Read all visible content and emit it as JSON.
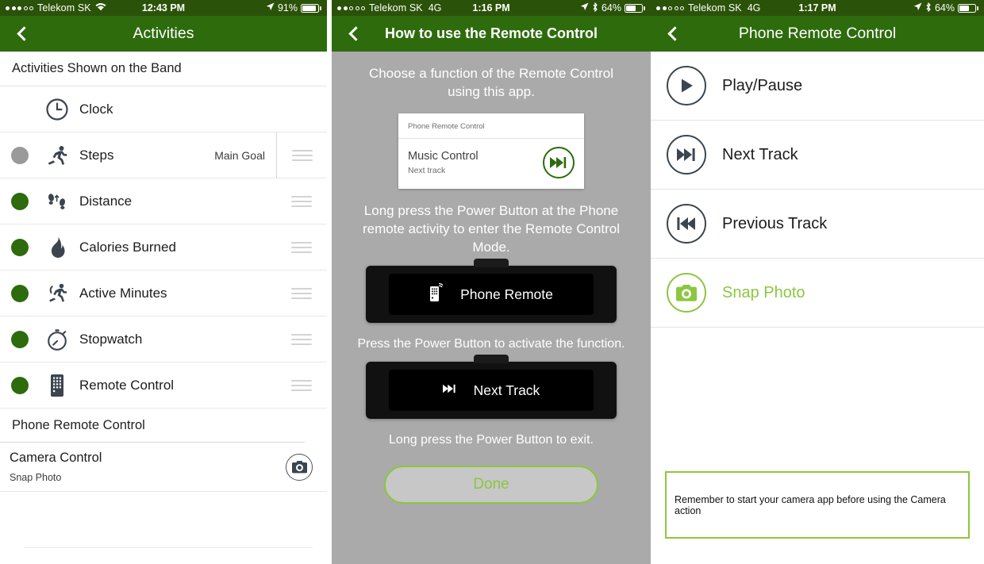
{
  "panel1": {
    "status": {
      "carrier": "Telekom SK",
      "network": "wifi",
      "time": "12:43 PM",
      "battery": "91%",
      "battery_pct": 91,
      "signal_filled": 3,
      "signal_total": 5
    },
    "nav": {
      "title": "Activities",
      "back": "back-chevron"
    },
    "section_header": "Activities Shown on the Band",
    "rows": [
      {
        "label": "Clock",
        "icon": "clock-icon",
        "toggle": "none",
        "badge": "",
        "handle": false,
        "separator": false
      },
      {
        "label": "Steps",
        "icon": "running-icon",
        "toggle": "off",
        "badge": "Main Goal",
        "handle": true,
        "separator": true
      },
      {
        "label": "Distance",
        "icon": "footsteps-icon",
        "toggle": "on",
        "badge": "",
        "handle": true,
        "separator": false
      },
      {
        "label": "Calories Burned",
        "icon": "flame-icon",
        "toggle": "on",
        "badge": "",
        "handle": true,
        "separator": false
      },
      {
        "label": "Active Minutes",
        "icon": "active-runner-icon",
        "toggle": "on",
        "badge": "",
        "handle": true,
        "separator": false
      },
      {
        "label": "Stopwatch",
        "icon": "stopwatch-icon",
        "toggle": "on",
        "badge": "",
        "handle": true,
        "separator": false
      },
      {
        "label": "Remote Control",
        "icon": "remote-icon",
        "toggle": "on",
        "badge": "",
        "handle": true,
        "separator": false
      }
    ],
    "sub_header": "Phone Remote Control",
    "camera_row": {
      "title": "Camera Control",
      "subtitle": "Snap Photo",
      "icon": "camera-icon"
    }
  },
  "panel2": {
    "status": {
      "carrier": "Telekom SK",
      "network": "4G",
      "time": "1:16 PM",
      "battery": "64%",
      "battery_pct": 64,
      "signal_filled": 2,
      "signal_total": 5
    },
    "nav": {
      "title": "How to use the Remote Control",
      "back": "back-chevron"
    },
    "caption1": "Choose a function of the Remote Control using this app.",
    "card": {
      "header": "Phone Remote Control",
      "title": "Music Control",
      "subtitle": "Next track",
      "icon": "next-track-icon"
    },
    "caption2": "Long press the Power Button at the Phone remote activity to enter the Remote Control Mode.",
    "band1": {
      "label": "Phone Remote",
      "icon": "remote-signal-icon"
    },
    "caption3": "Press the Power Button to activate the function.",
    "band2": {
      "label": "Next Track",
      "icon": "next-track-icon"
    },
    "caption4": "Long press the Power Button to exit.",
    "done_label": "Done"
  },
  "panel3": {
    "status": {
      "carrier": "Telekom SK",
      "network": "4G",
      "time": "1:17 PM",
      "battery": "64%",
      "battery_pct": 64,
      "signal_filled": 2,
      "signal_total": 5
    },
    "nav": {
      "title": "Phone Remote Control",
      "back": "back-chevron"
    },
    "rows": [
      {
        "label": "Play/Pause",
        "icon": "play-icon",
        "selected": false
      },
      {
        "label": "Next Track",
        "icon": "next-track-icon",
        "selected": false
      },
      {
        "label": "Previous Track",
        "icon": "previous-track-icon",
        "selected": false
      },
      {
        "label": "Snap Photo",
        "icon": "camera-icon",
        "selected": true
      }
    ],
    "note": "Remember to start your camera app before using the Camera action"
  },
  "colors": {
    "status_green": "#2b5209",
    "nav_green": "#2e6b0d",
    "toggle_on": "#2d6b0d",
    "toggle_off": "#9a9a9a",
    "accent_light_green": "#8dc63f",
    "panel2_bg": "#aaaaaa",
    "icon_dark": "#3b4550"
  }
}
